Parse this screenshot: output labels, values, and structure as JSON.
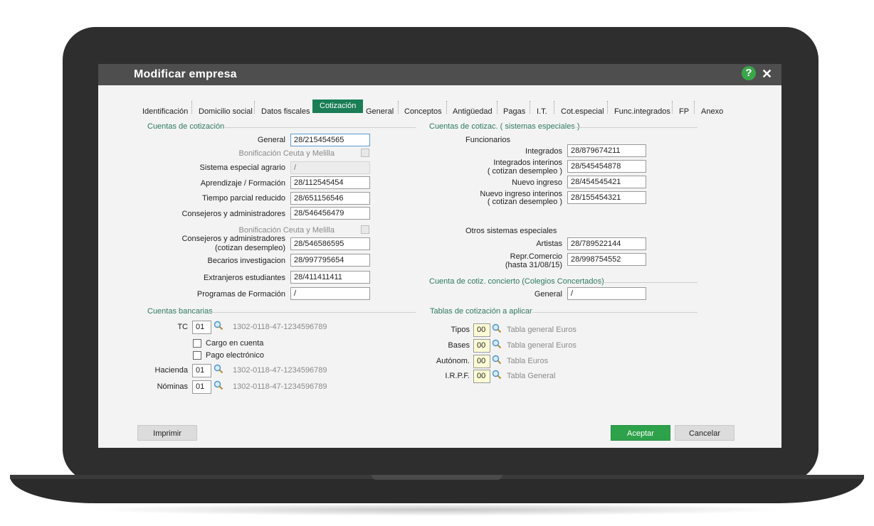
{
  "window": {
    "title": "Modificar empresa"
  },
  "tabs": [
    "Identificación",
    "Domicilio social",
    "Datos fiscales",
    "Cotización",
    "General",
    "Conceptos",
    "Antigüedad",
    "Pagas",
    "I.T.",
    "Cot.especial",
    "Func.integrados",
    "FP",
    "Anexo"
  ],
  "left": {
    "section_title": "Cuentas de cotización",
    "general_label": "General",
    "general_value": "28/215454565",
    "bonificacion1": "Bonificación Ceuta y Melilla",
    "agrario_label": "Sistema especial agrario",
    "agrario_value": "/",
    "aprendizaje_label": "Aprendizaje / Formación",
    "aprendizaje_value": "28/112545454",
    "parcial_label": "Tiempo parcial reducido",
    "parcial_value": "28/651156546",
    "consejeros_label": "Consejeros y administradores",
    "consejeros_value": "28/546456479",
    "bonificacion2": "Bonificación Ceuta y Melilla",
    "consejeros_desempleo_label1": "Consejeros  y administradores",
    "consejeros_desempleo_label2": "(cotizan desempleo)",
    "consejeros_desempleo_value": "28/546586595",
    "becarios_label": "Becarios investigacion",
    "becarios_value": "28/997795654",
    "extranjeros_label": "Extranjeros estudiantes",
    "extranjeros_value": "28/411411411",
    "programas_label": "Programas de Formación",
    "programas_value": "/"
  },
  "right": {
    "section_title": "Cuentas de cotizac. ( sistemas especiales )",
    "funcionarios": "Funcionarios",
    "integrados_label": "Integrados",
    "integrados_value": "28/879674211",
    "int_interinos_label1": "Integrados interinos",
    "int_interinos_label2": "( cotizan desempleo )",
    "int_interinos_value": "28/545454878",
    "nuevo_label": "Nuevo ingreso",
    "nuevo_value": "28/454545421",
    "nuevo_interinos_label1": "Nuevo ingreso interinos",
    "nuevo_interinos_label2": "( cotizan desempleo )",
    "nuevo_interinos_value": "28/155454321",
    "otros": "Otros sistemas especiales",
    "artistas_label": "Artistas",
    "artistas_value": "28/789522144",
    "repr_label1": "Repr.Comercio",
    "repr_label2": "(hasta 31/08/15)",
    "repr_value": "28/998754552",
    "concierto_title": "Cuenta de cotiz. concierto (Colegios Concertados)",
    "concierto_general_label": "General",
    "concierto_general_value": "/"
  },
  "bancarias": {
    "section_title": "Cuentas bancarias",
    "tc_label": "TC",
    "tc_code": "01",
    "tc_account": "1302-0118-47-1234596789",
    "cargo_label": "Cargo en cuenta",
    "pago_label": "Pago electrónico",
    "hacienda_label": "Hacienda",
    "hacienda_code": "01",
    "hacienda_account": "1302-0118-47-1234596789",
    "nominas_label": "Nóminas",
    "nominas_code": "01",
    "nominas_account": "1302-0118-47-1234596789"
  },
  "tablas": {
    "section_title": "Tablas de cotización a aplicar",
    "tipos_label": "Tipos",
    "tipos_code": "00",
    "tipos_desc": "Tabla general Euros",
    "bases_label": "Bases",
    "bases_code": "00",
    "bases_desc": "Tabla general Euros",
    "autonom_label": "Autónom.",
    "autonom_code": "00",
    "autonom_desc": "Tabla Euros",
    "irpf_label": "I.R.P.F.",
    "irpf_code": "00",
    "irpf_desc": "Tabla General"
  },
  "buttons": {
    "imprimir": "Imprimir",
    "aceptar": "Aceptar",
    "cancelar": "Cancelar"
  },
  "colors": {
    "accent": "#1a7d55",
    "accept": "#2ea24a",
    "section": "#2e7a5e",
    "titlebar": "#4e4e4e"
  },
  "icons": {
    "help": "help-icon",
    "close": "close-icon",
    "search": "magnifier-icon"
  }
}
